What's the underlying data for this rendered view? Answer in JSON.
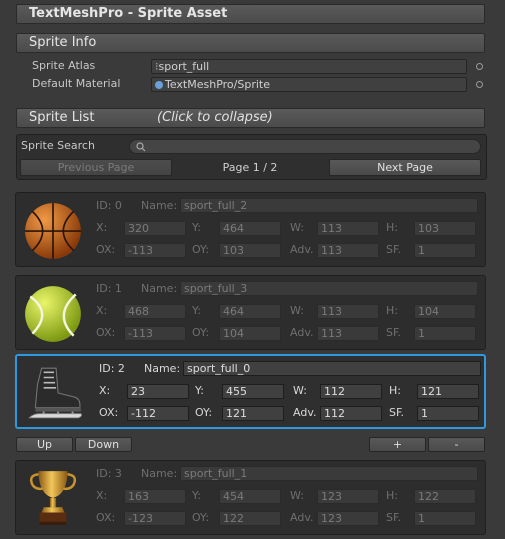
{
  "title": "TextMeshPro - Sprite Asset",
  "sprite_info": {
    "header": "Sprite Info",
    "atlas_label": "Sprite Atlas",
    "atlas_value": "sport_full",
    "material_label": "Default Material",
    "material_value": "TextMeshPro/Sprite"
  },
  "sprite_list": {
    "header": "Sprite List",
    "hint": "(Click to collapse)"
  },
  "search": {
    "label": "Sprite Search",
    "prev_label": "Previous Page",
    "page_text": "Page 1 / 2",
    "next_label": "Next Page"
  },
  "field_labels": {
    "id": "ID:",
    "name": "Name:",
    "x": "X:",
    "y": "Y:",
    "w": "W:",
    "h": "H:",
    "ox": "OX:",
    "oy": "OY:",
    "adv": "Adv.",
    "sf": "SF."
  },
  "sprites": [
    {
      "id": "0",
      "name": "sport_full_2",
      "x": "320",
      "y": "464",
      "w": "113",
      "h": "103",
      "ox": "-113",
      "oy": "103",
      "adv": "113",
      "sf": "1",
      "icon": "basketball-icon"
    },
    {
      "id": "1",
      "name": "sport_full_3",
      "x": "468",
      "y": "464",
      "w": "113",
      "h": "104",
      "ox": "-113",
      "oy": "104",
      "adv": "113",
      "sf": "1",
      "icon": "tennis-ball-icon"
    },
    {
      "id": "2",
      "name": "sport_full_0",
      "x": "23",
      "y": "455",
      "w": "112",
      "h": "121",
      "ox": "-112",
      "oy": "121",
      "adv": "112",
      "sf": "1",
      "icon": "ice-skate-icon"
    },
    {
      "id": "3",
      "name": "sport_full_1",
      "x": "163",
      "y": "454",
      "w": "123",
      "h": "122",
      "ox": "-123",
      "oy": "122",
      "adv": "123",
      "sf": "1",
      "icon": "trophy-icon"
    }
  ],
  "row_buttons": {
    "up": "Up",
    "down": "Down",
    "add": "+",
    "remove": "-"
  },
  "colors": {
    "selection": "#2e98e0",
    "background": "#3a3a3a"
  }
}
